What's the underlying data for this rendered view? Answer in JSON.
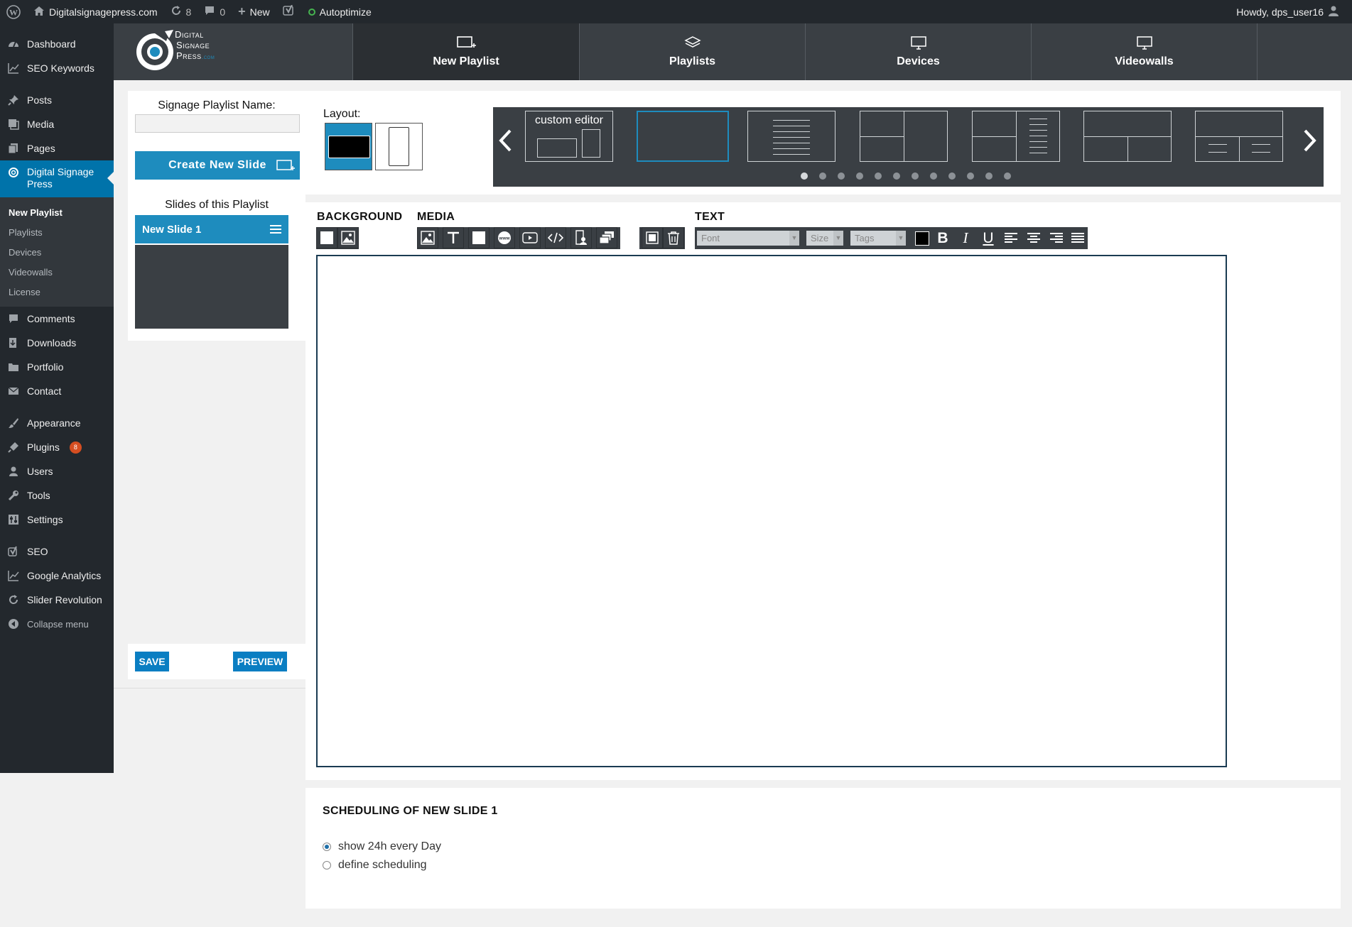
{
  "admin_bar": {
    "site_name": "Digitalsignagepress.com",
    "updates_count": "8",
    "comments_count": "0",
    "new_label": "New",
    "autoptimize_label": "Autoptimize",
    "howdy": "Howdy, dps_user16"
  },
  "admin_menu": {
    "items": [
      {
        "label": "Dashboard",
        "icon": "dashboard-icon"
      },
      {
        "label": "SEO Keywords",
        "icon": "chart-icon"
      },
      {
        "label": "Posts",
        "icon": "pin-icon"
      },
      {
        "label": "Media",
        "icon": "media-icon"
      },
      {
        "label": "Pages",
        "icon": "pages-icon"
      },
      {
        "label": "Digital Signage Press",
        "icon": "dsp-icon"
      },
      {
        "label": "Comments",
        "icon": "comment-icon"
      },
      {
        "label": "Downloads",
        "icon": "download-icon"
      },
      {
        "label": "Portfolio",
        "icon": "folder-icon"
      },
      {
        "label": "Contact",
        "icon": "mail-icon"
      },
      {
        "label": "Appearance",
        "icon": "brush-icon"
      },
      {
        "label": "Plugins",
        "icon": "plug-icon",
        "badge": "8"
      },
      {
        "label": "Users",
        "icon": "user-icon"
      },
      {
        "label": "Tools",
        "icon": "wrench-icon"
      },
      {
        "label": "Settings",
        "icon": "settings-icon"
      },
      {
        "label": "SEO",
        "icon": "yoast-icon"
      },
      {
        "label": "Google Analytics",
        "icon": "chart-icon"
      },
      {
        "label": "Slider Revolution",
        "icon": "refresh-icon"
      }
    ],
    "submenu": [
      "New Playlist",
      "Playlists",
      "Devices",
      "Videowalls",
      "License"
    ],
    "collapse_label": "Collapse menu"
  },
  "dsp_header": {
    "logo_lines": [
      "Digital",
      "Signage",
      "Press"
    ],
    "logo_suffix": ".com",
    "tabs": [
      "New Playlist",
      "Playlists",
      "Devices",
      "Videowalls"
    ]
  },
  "left_panel": {
    "playlist_name_label": "Signage Playlist Name:",
    "playlist_name_value": "",
    "create_slide_label": "Create New Slide",
    "slides_heading": "Slides of this Playlist",
    "slides": [
      "New Slide 1"
    ],
    "save_label": "SAVE",
    "preview_label": "PREVIEW"
  },
  "layout_panel": {
    "label": "Layout:",
    "custom_editor_label": "custom editor",
    "dot_count": 12,
    "active_dot": 0
  },
  "editor": {
    "background_title": "BACKGROUND",
    "media_title": "MEDIA",
    "text_title": "TEXT",
    "font_placeholder": "Font",
    "size_placeholder": "Size",
    "tags_placeholder": "Tags"
  },
  "scheduling": {
    "title": "SCHEDULING OF NEW SLIDE 1",
    "options": [
      "show 24h every Day",
      "define scheduling"
    ],
    "selected": 0
  },
  "colors": {
    "accent": "#1e8cbe",
    "admin_dark": "#23282d",
    "panel_dark": "#3a3f44"
  }
}
